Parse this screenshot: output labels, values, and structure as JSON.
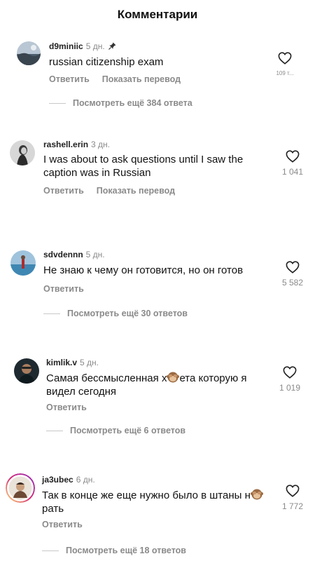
{
  "header": {
    "title": "Комментарии"
  },
  "comments": [
    {
      "username": "d9miniic",
      "age": "5 дн.",
      "text": "russian citizenship exam",
      "reply_label": "Ответить",
      "translate_label": "Показать перевод",
      "likes": "109 т...",
      "replies_label": "Посмотреть ещё 384 ответа"
    },
    {
      "username": "rashell.erin",
      "age": "3 дн.",
      "text": "I was about to ask questions until I saw the caption was in Russian",
      "reply_label": "Ответить",
      "translate_label": "Показать перевод",
      "likes": "1 041"
    },
    {
      "username": "sdvdennn",
      "age": "5 дн.",
      "text": "Не знаю к чему он готовится, но он готов",
      "reply_label": "Ответить",
      "likes": "5 582",
      "replies_label": "Посмотреть ещё 30 ответов"
    },
    {
      "username": "kimlik.v",
      "age": "5 дн.",
      "text_a": "Самая бессмысленная х",
      "text_b": "ета которую я видел сегодня",
      "reply_label": "Ответить",
      "likes": "1 019",
      "replies_label": "Посмотреть ещё 6 ответов"
    },
    {
      "username": "ja3ubec",
      "age": "6 дн.",
      "text_a": "Так в конце же еще нужно было в штаны н",
      "text_b": "рать",
      "reply_label": "Ответить",
      "likes": "1 772",
      "replies_label": "Посмотреть ещё 18 ответов"
    }
  ],
  "icons": {
    "heart": "heart-outline-icon",
    "pin": "pin-icon",
    "emoji": "see-no-evil-monkey-emoji"
  },
  "colors": {
    "text": "#111111",
    "muted": "#8a8a8a",
    "divider": "#c8c8c8",
    "story_ring": "#d6249f"
  }
}
